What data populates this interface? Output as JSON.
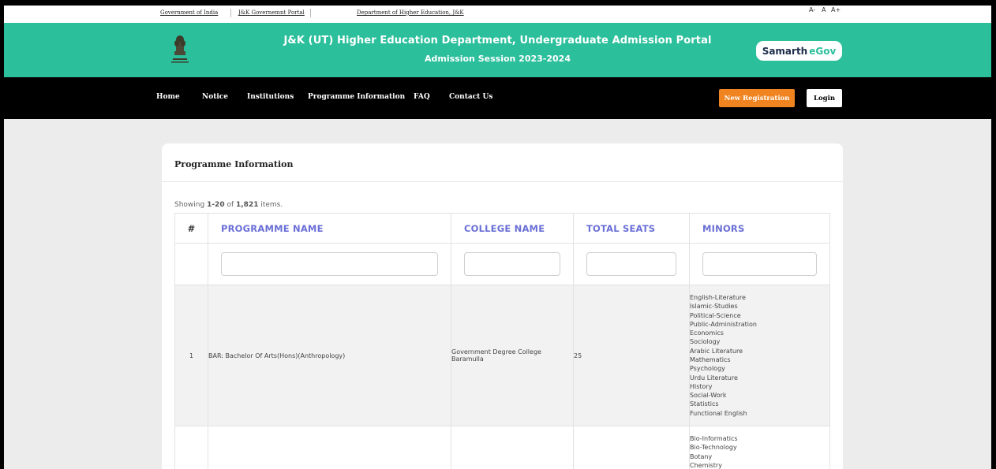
{
  "topbar": {
    "links": [
      "Government of India",
      "J&K Governemnt Portal",
      "Department of Higher Education, J&K"
    ],
    "font_controls": [
      "A-",
      "A",
      "A+"
    ]
  },
  "header": {
    "title": "J&K (UT) Higher Education Department, Undergraduate Admission Portal",
    "subtitle": "Admission Session 2023-2024",
    "brand_part1": "Samarth",
    "brand_part2": "eGov"
  },
  "nav": {
    "items": [
      "Home",
      "Notice",
      "Institutions",
      "Programme Information",
      "FAQ",
      "Contact Us"
    ],
    "register_label": "New Registration",
    "login_label": "Login"
  },
  "card": {
    "title": "Programme Information",
    "summary_prefix": "Showing ",
    "summary_range": "1-20",
    "summary_of": " of ",
    "summary_total": "1,821",
    "summary_suffix": " items."
  },
  "table": {
    "headers": [
      "#",
      "PROGRAMME NAME",
      "COLLEGE NAME",
      "TOTAL SEATS",
      "MINORS"
    ],
    "rows": [
      {
        "index": "1",
        "programme": "BAR: Bachelor Of Arts(Hons)(Anthropology)",
        "college": "Government Degree College Baramulla",
        "seats": "25",
        "minors": [
          "English-Literature",
          "Islamic-Studies",
          "Political-Science",
          "Public-Administration",
          "Economics",
          "Sociology",
          "Arabic Literature",
          "Mathematics",
          "Psychology",
          "Urdu Literature",
          "History",
          "Social-Work",
          "Statistics",
          "Functional English"
        ]
      },
      {
        "index": "",
        "programme": "",
        "college": "",
        "seats": "",
        "minors": [
          "Bio-Informatics",
          "Bio-Technology",
          "Botany",
          "Chemistry"
        ]
      }
    ]
  },
  "colors": {
    "header_bg": "#2bbf9c",
    "nav_bg": "#000000",
    "register_button": "#f08421",
    "table_header_text": "#6a6fd6"
  }
}
